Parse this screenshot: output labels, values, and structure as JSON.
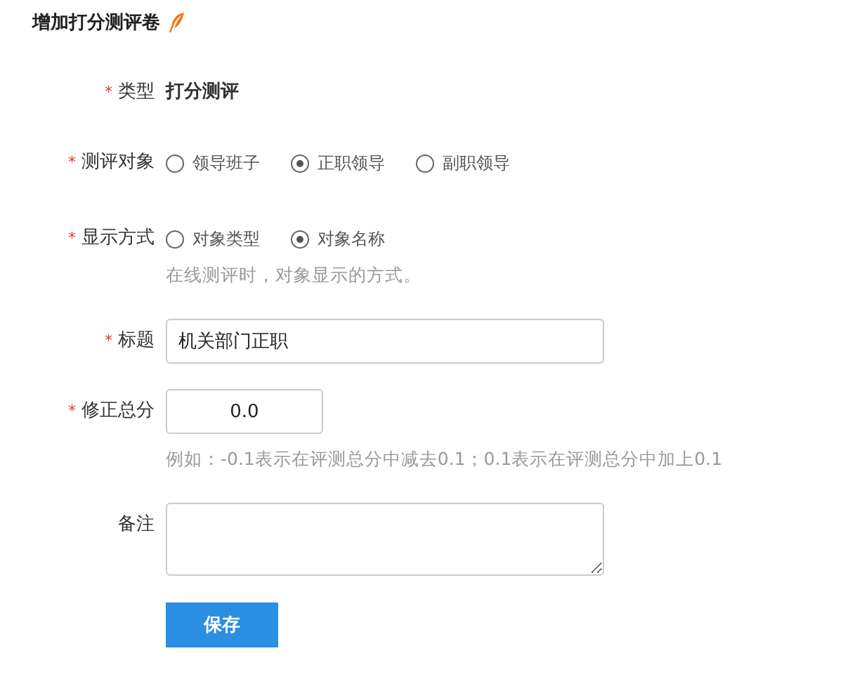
{
  "heading": {
    "title": "增加打分测评卷"
  },
  "fields": [
    {
      "kind": "static",
      "required_mark": "*",
      "label": "类型",
      "value": "打分测评"
    },
    {
      "kind": "radio",
      "required_mark": "*",
      "label": "测评对象",
      "options": [
        {
          "label": "领导班子",
          "selected": false
        },
        {
          "label": "正职领导",
          "selected": true
        },
        {
          "label": "副职领导",
          "selected": false
        }
      ]
    },
    {
      "kind": "radio",
      "required_mark": "*",
      "label": "显示方式",
      "options": [
        {
          "label": "对象类型",
          "selected": false
        },
        {
          "label": "对象名称",
          "selected": true
        }
      ],
      "hint": "在线测评时，对象显示的方式。"
    },
    {
      "kind": "text",
      "required_mark": "*",
      "label": "标题",
      "value": "机关部门正职"
    },
    {
      "kind": "number",
      "required_mark": "*",
      "label": "修正总分",
      "value": "0.0",
      "hint": "例如：-0.1表示在评测总分中减去0.1；0.1表示在评测总分中加上0.1"
    },
    {
      "kind": "textarea",
      "label": "备注"
    }
  ],
  "submit": {
    "label": "保存"
  }
}
